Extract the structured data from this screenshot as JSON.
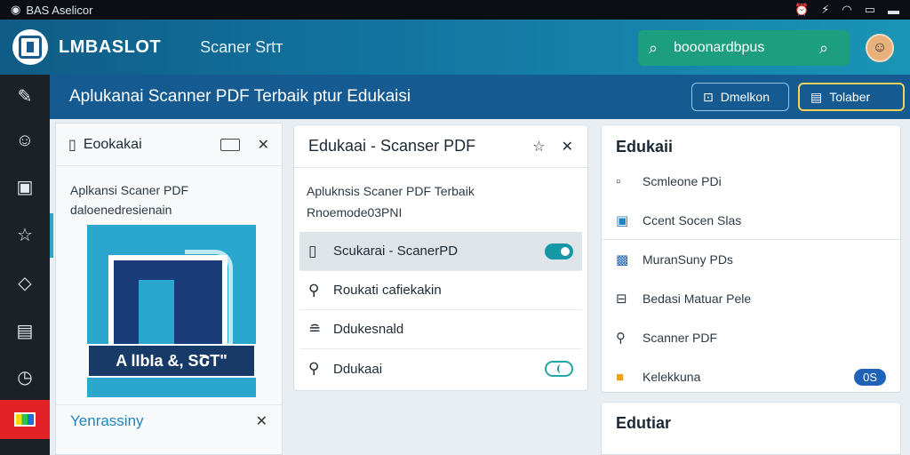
{
  "statusbar": {
    "app_name": "BAS Aselicor",
    "icons": [
      "alarm-icon",
      "signal-icon",
      "wifi-icon",
      "battery-icon",
      "minimize-icon"
    ]
  },
  "header": {
    "brand": "LMBASLOT",
    "page_name": "Scaner Srtт",
    "search": {
      "value": "booonardbpus"
    }
  },
  "rail": {
    "items": [
      "pen-icon",
      "user-icon",
      "image-icon",
      "star-icon",
      "diamond-icon",
      "card-icon",
      "clock-icon",
      "flag-icon"
    ]
  },
  "subheader": {
    "title": "Aplukanai Scanner PDF Terbaik ptur Edukaisi",
    "btn_ghost": "Dmelkon",
    "btn_primary": "Tolaber"
  },
  "panel1": {
    "title": "Eookakai",
    "desc_line1": "Aplkansi Scaner PDF",
    "desc_line2": "daloenedresienain",
    "thumb_caption": "A lIbIa &, SՇT\"",
    "footer_link": "Yenrassiny"
  },
  "panel2": {
    "title": "Edukaai - Scanser PDF",
    "desc_line1": "Apluknsis Scaner PDF Terbaik",
    "desc_line2": "Rnoemode03PNI",
    "rows": [
      {
        "label": "Scukarai - ScanerPD",
        "toggle": "on"
      },
      {
        "label": "Roukati cafiekakin",
        "toggle": ""
      },
      {
        "label": "Ddukesnald",
        "toggle": ""
      },
      {
        "label": "Ddukaai",
        "toggle": "off"
      }
    ]
  },
  "panel3": {
    "title": "Edukaii",
    "rows": [
      {
        "label": "Scmleone PDi"
      },
      {
        "label": "Ccent Socen Slas"
      },
      {
        "label": "MuranSuny PDs"
      },
      {
        "label": "Bedasi Matuar Pele"
      },
      {
        "label": "Scanner PDF"
      },
      {
        "label": "Kelekkuna",
        "badge": "0S"
      }
    ]
  },
  "panel4": {
    "title": "Edutiar"
  }
}
